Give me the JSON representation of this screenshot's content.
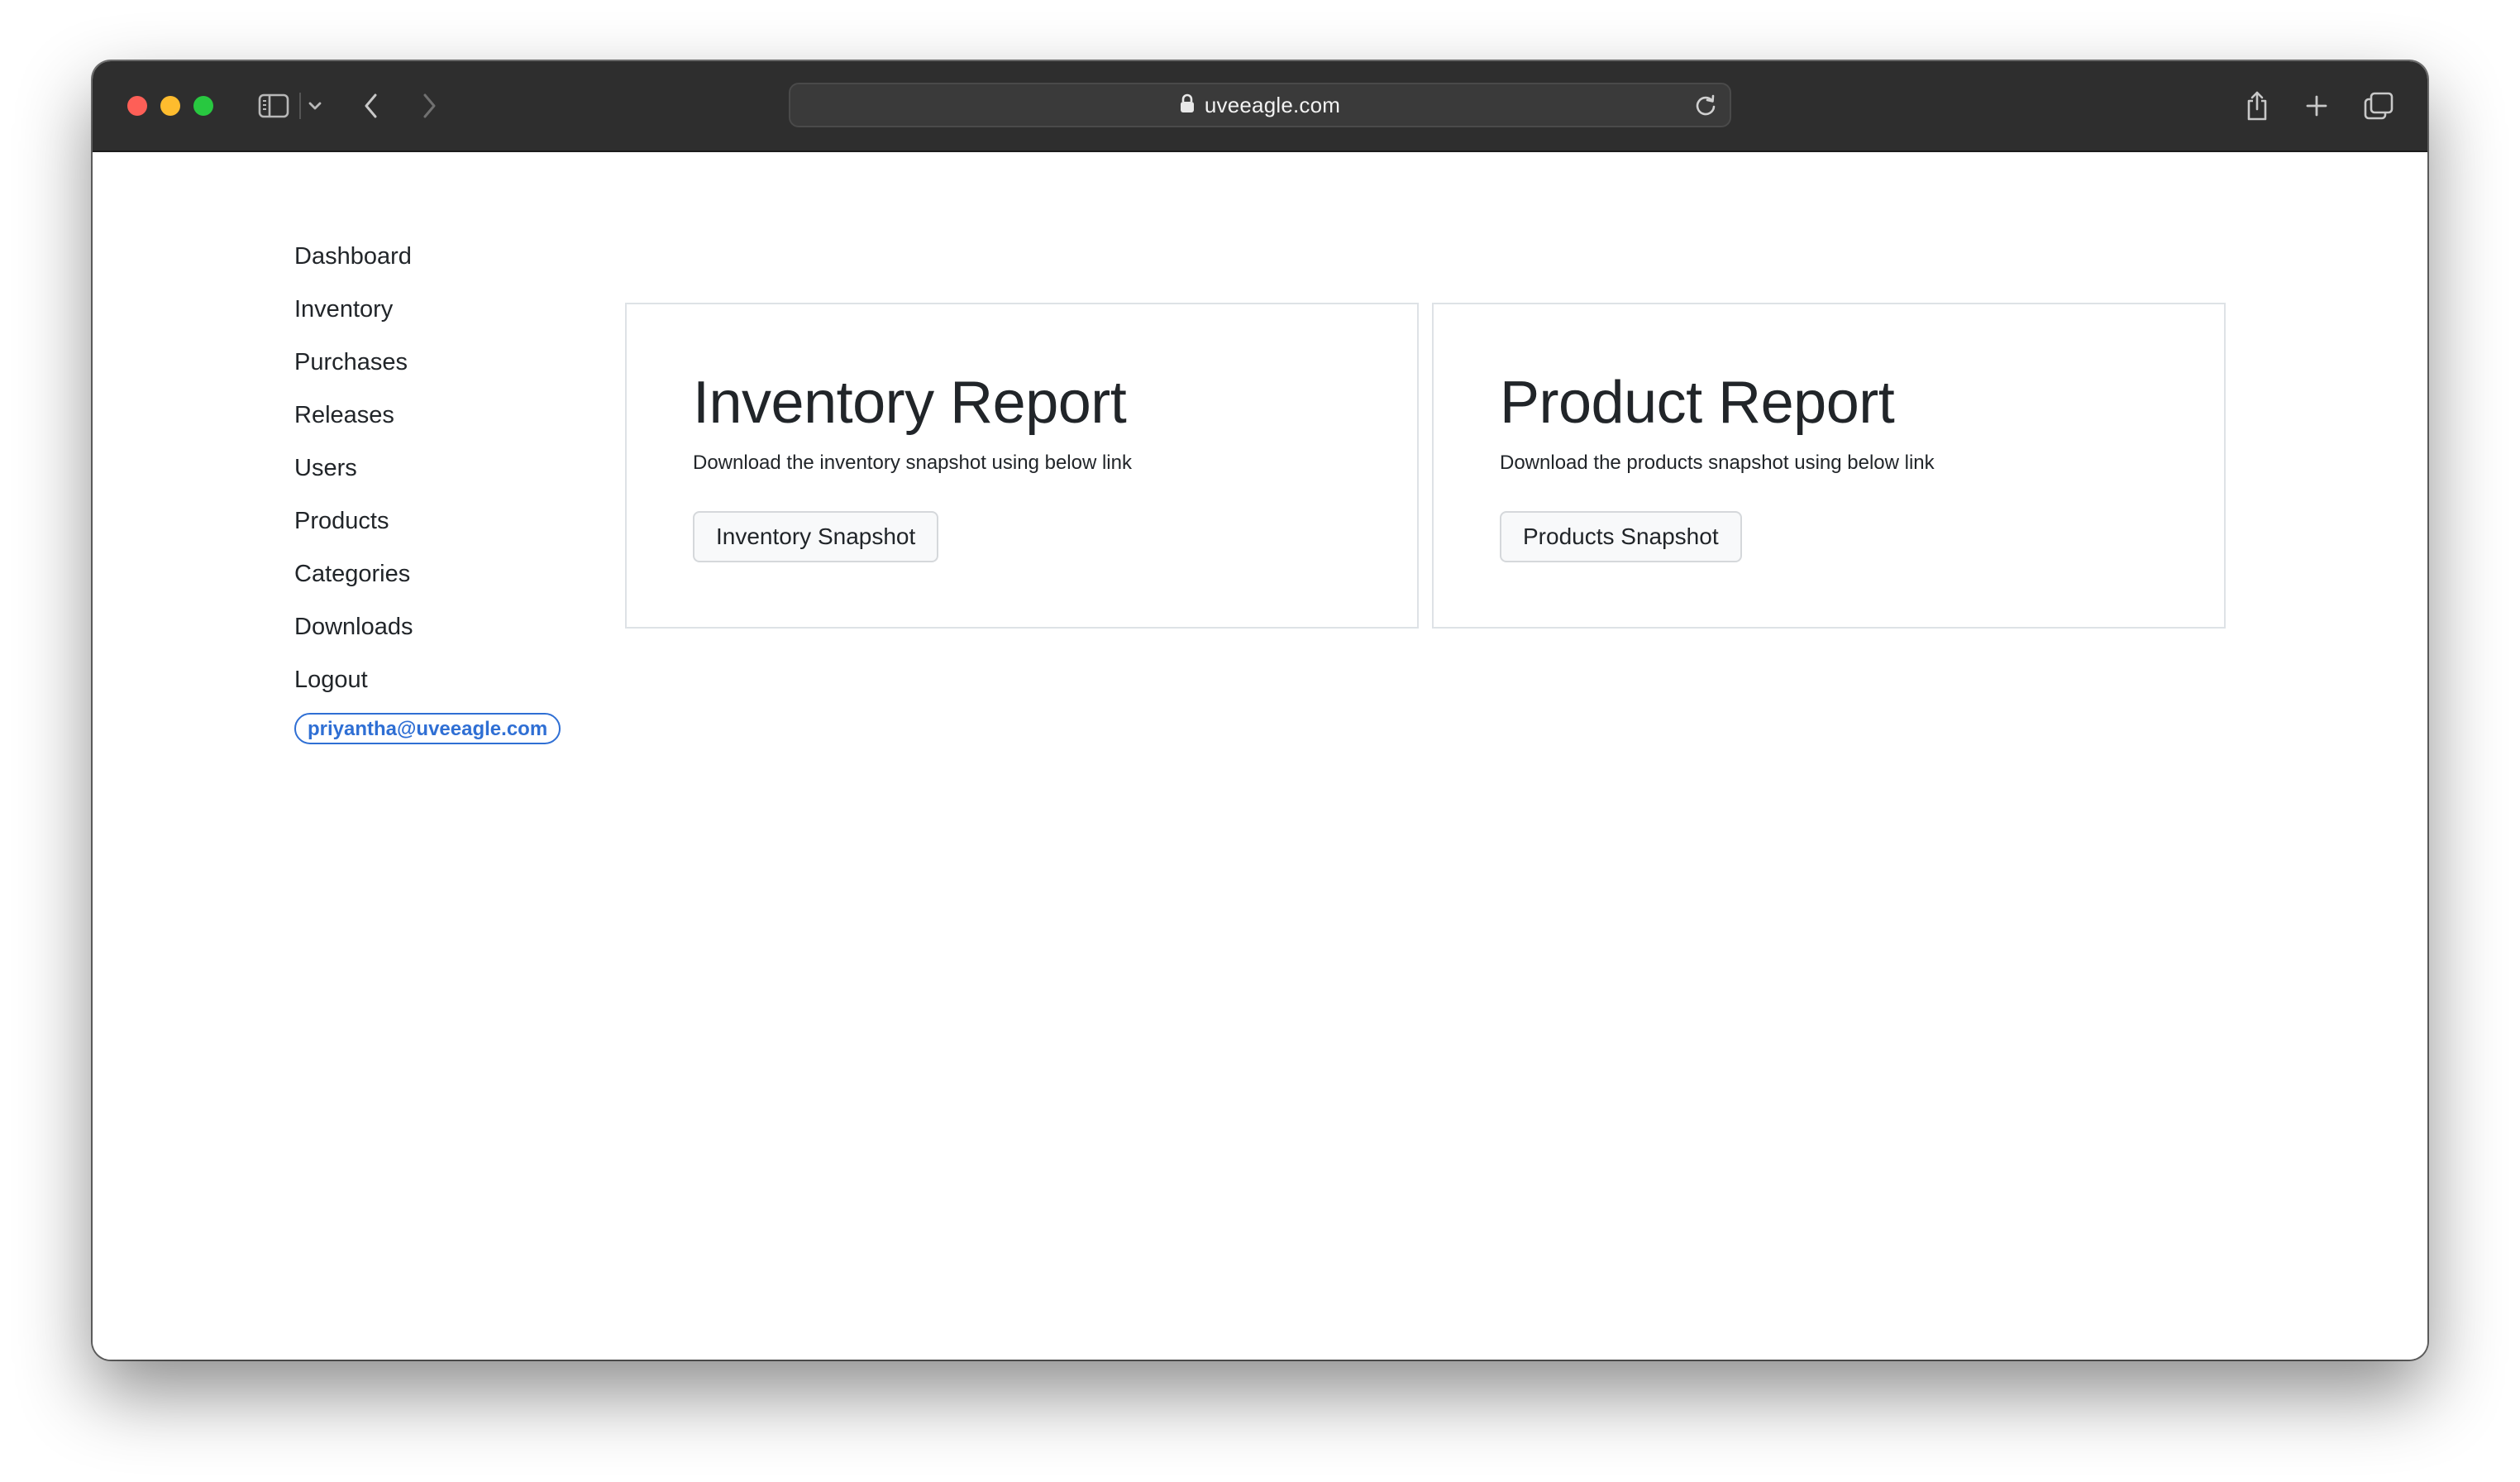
{
  "browser": {
    "url": "uveeagle.com"
  },
  "sidebar": {
    "items": [
      {
        "label": "Dashboard"
      },
      {
        "label": "Inventory"
      },
      {
        "label": "Purchases"
      },
      {
        "label": "Releases"
      },
      {
        "label": "Users"
      },
      {
        "label": "Products"
      },
      {
        "label": "Categories"
      },
      {
        "label": "Downloads"
      },
      {
        "label": "Logout"
      }
    ],
    "user_email": "priyantha@uveeagle.com"
  },
  "cards": [
    {
      "title": "Inventory Report",
      "description": "Download the inventory snapshot using below link",
      "button_label": "Inventory Snapshot"
    },
    {
      "title": "Product Report",
      "description": "Download the products snapshot using below link",
      "button_label": "Products Snapshot"
    }
  ],
  "colors": {
    "toolbar": "#2e2e2e",
    "accent": "#2f6fd4",
    "text": "#212529",
    "card_border": "#dee2e6"
  },
  "icons": {
    "traffic_lights": [
      "close-icon",
      "minimize-icon",
      "maximize-icon"
    ],
    "toolbar_left": [
      "sidebar-toggle-icon",
      "chevron-down-icon",
      "back-icon",
      "forward-icon"
    ],
    "url": [
      "lock-icon",
      "reload-icon"
    ],
    "toolbar_right": [
      "share-icon",
      "new-tab-icon",
      "tab-overview-icon"
    ]
  }
}
